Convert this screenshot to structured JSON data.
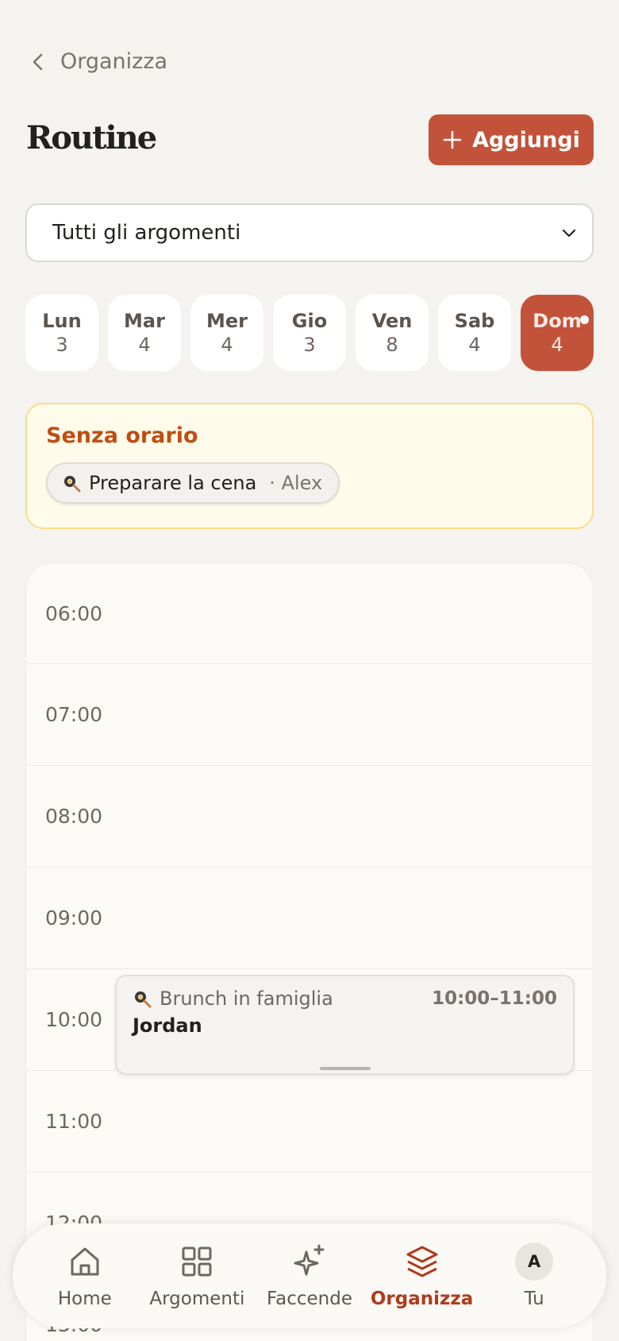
{
  "header": {
    "back_label": "Organizza",
    "title": "Routine",
    "add_label": "Aggiungi"
  },
  "topic_filter": {
    "selected": "Tutti gli argomenti"
  },
  "days": [
    {
      "name": "Lun",
      "count": "3",
      "active": false
    },
    {
      "name": "Mar",
      "count": "4",
      "active": false
    },
    {
      "name": "Mer",
      "count": "4",
      "active": false
    },
    {
      "name": "Gio",
      "count": "3",
      "active": false
    },
    {
      "name": "Ven",
      "count": "8",
      "active": false
    },
    {
      "name": "Sab",
      "count": "4",
      "active": false
    },
    {
      "name": "Dom",
      "count": "4",
      "active": true
    }
  ],
  "untimed": {
    "title": "Senza orario",
    "tasks": [
      {
        "name": "Preparare la cena",
        "assignee": "· Alex",
        "icon": "frying-pan-icon"
      }
    ]
  },
  "timeline": {
    "hours": [
      "06:00",
      "07:00",
      "08:00",
      "09:00",
      "10:00",
      "11:00",
      "12:00",
      "13:00"
    ],
    "events": [
      {
        "name": "Brunch in famiglia",
        "time": "10:00–11:00",
        "assignee": "Jordan",
        "icon": "frying-pan-icon",
        "start_hour": "10:00"
      }
    ]
  },
  "nav": {
    "items": [
      {
        "label": "Home",
        "icon": "home-icon",
        "active": false
      },
      {
        "label": "Argomenti",
        "icon": "grid-icon",
        "active": false
      },
      {
        "label": "Faccende",
        "icon": "sparkle-icon",
        "active": false
      },
      {
        "label": "Organizza",
        "icon": "layers-icon",
        "active": true
      },
      {
        "label": "Tu",
        "icon": "avatar",
        "active": false,
        "avatar_letter": "A"
      }
    ]
  },
  "colors": {
    "accent": "#c2533a",
    "background": "#f5f3ef",
    "untimed_bg": "#fffbea",
    "untimed_title": "#bf4e13"
  }
}
